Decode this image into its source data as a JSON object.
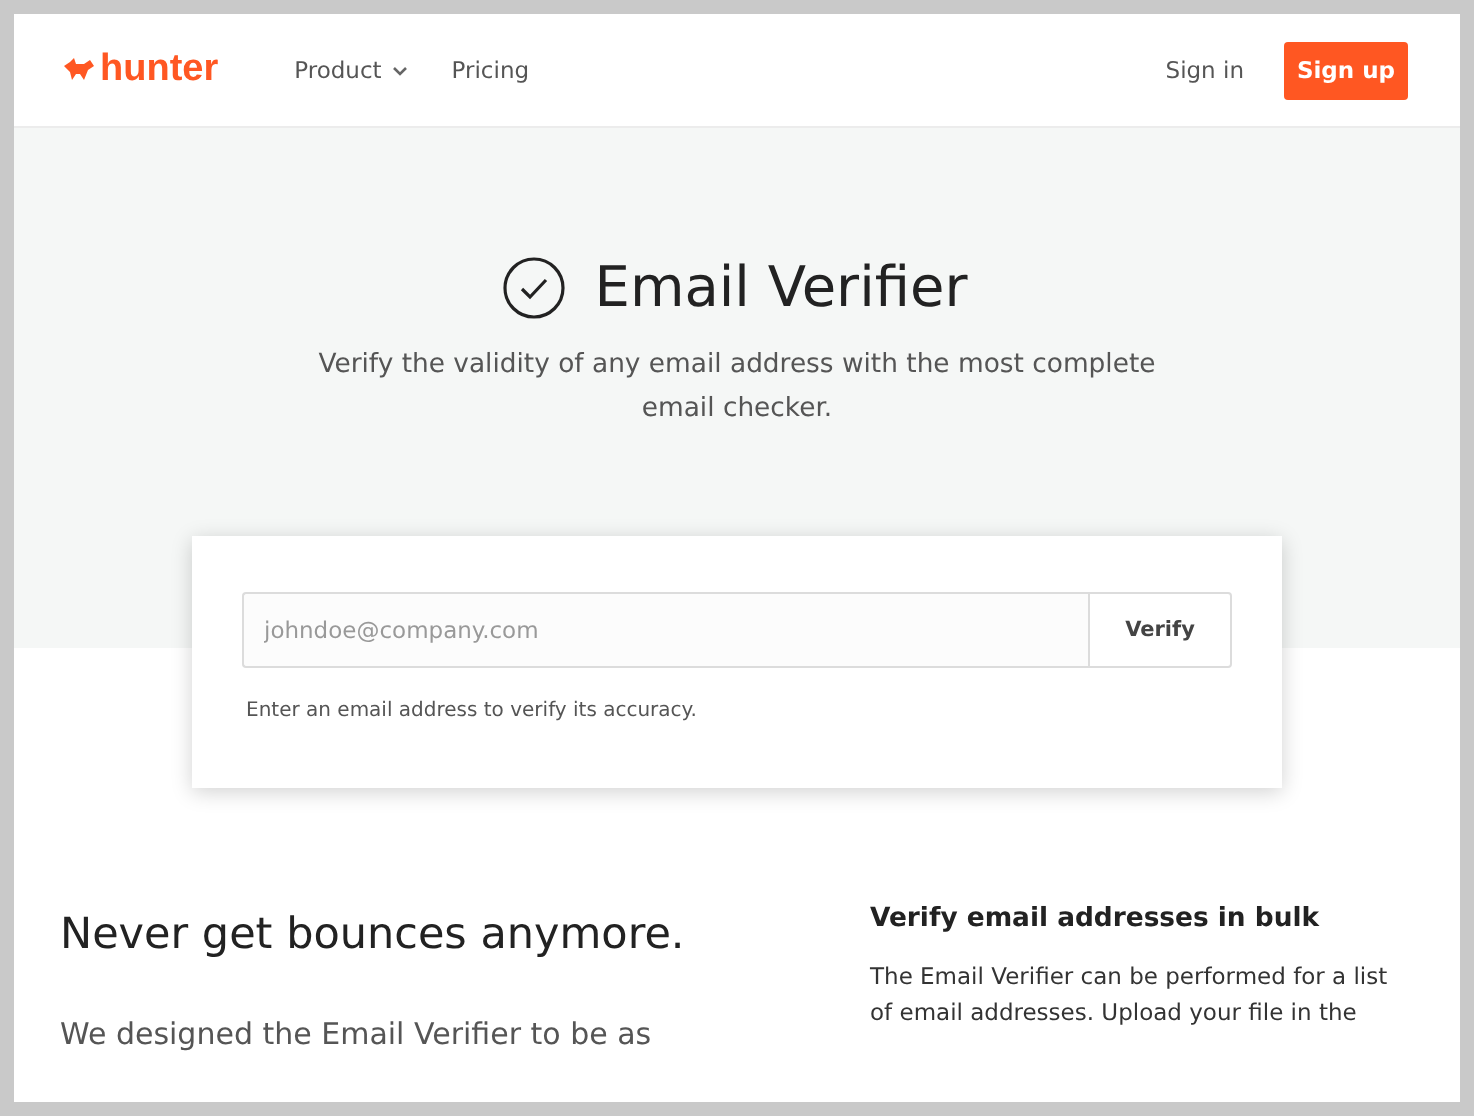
{
  "header": {
    "logo": "hunter",
    "nav": [
      {
        "label": "Product",
        "dropdown": true
      },
      {
        "label": "Pricing",
        "dropdown": false
      }
    ],
    "sign_in": "Sign in",
    "sign_up": "Sign up"
  },
  "hero": {
    "title": "Email Verifier",
    "subtitle": "Verify the validity of any email address with the most complete email checker."
  },
  "verifier": {
    "placeholder": "johndoe@company.com",
    "button": "Verify",
    "hint": "Enter an email address to verify its accuracy."
  },
  "left": {
    "heading": "Never get bounces anymore.",
    "text": "We designed the Email Verifier to be as"
  },
  "right": {
    "heading": "Verify email addresses in bulk",
    "text": "The Email Verifier can be performed for a list of email addresses. Upload your file in the"
  }
}
